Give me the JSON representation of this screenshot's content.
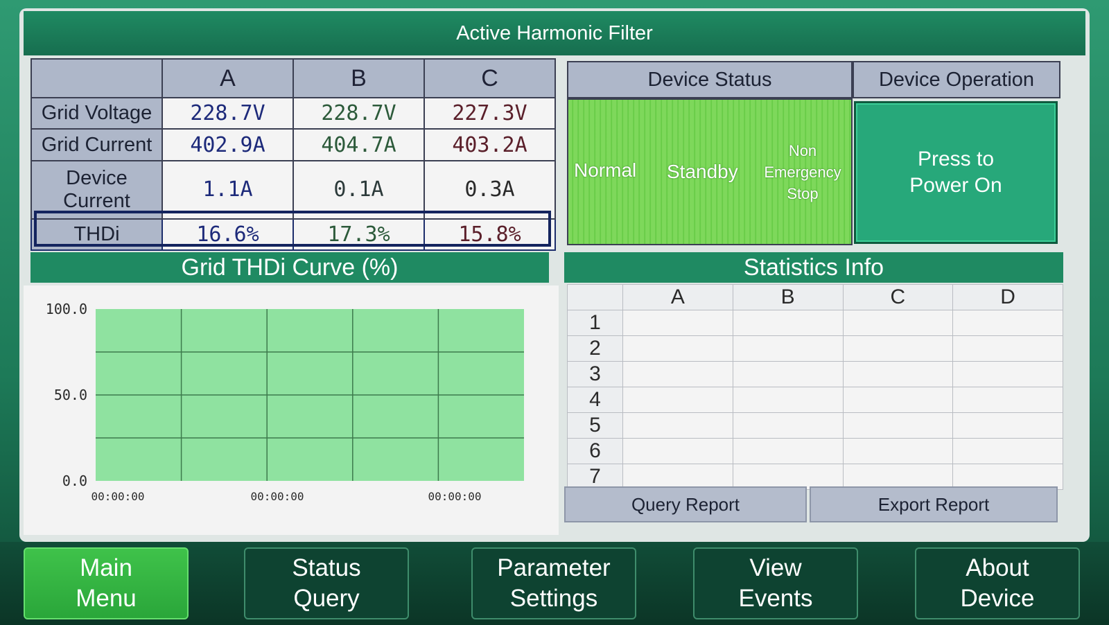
{
  "app": {
    "title": "Active Harmonic Filter"
  },
  "phase_table": {
    "columns": [
      "A",
      "B",
      "C"
    ],
    "rows": [
      {
        "label": "Grid Voltage",
        "values": [
          "228.7V",
          "228.7V",
          "227.3V"
        ]
      },
      {
        "label": "Grid Current",
        "values": [
          "402.9A",
          "404.7A",
          "403.2A"
        ]
      },
      {
        "label": "Device Current",
        "values": [
          "1.1A",
          "0.1A",
          "0.3A"
        ]
      },
      {
        "label": "THDi",
        "values": [
          "16.6%",
          "17.3%",
          "15.8%"
        ]
      }
    ]
  },
  "device_status": {
    "header": "Device Status",
    "states": [
      "Normal",
      "Standby",
      "Non Emergency Stop"
    ],
    "indicator_color": "#7ed85b"
  },
  "device_operation": {
    "header": "Device Operation",
    "button_label": "Press to Power On",
    "button_color": "#27a87a"
  },
  "thdi_curve": {
    "title": "Grid THDi Curve (%)",
    "y_ticks": [
      "100.0",
      "50.0",
      "0.0"
    ],
    "x_ticks": [
      "00:00:00",
      "00:00:00",
      "00:00:00"
    ],
    "plot_color": "#8fe2a0"
  },
  "chart_data": {
    "type": "line",
    "title": "Grid THDi Curve (%)",
    "ylim": [
      0,
      100
    ],
    "y_ticks": [
      100,
      50,
      0
    ],
    "x_tick_labels": [
      "00:00:00",
      "00:00:00",
      "00:00:00"
    ],
    "series": [],
    "grid": true
  },
  "statistics": {
    "title": "Statistics Info",
    "columns": [
      "A",
      "B",
      "C",
      "D"
    ],
    "rows": [
      "1",
      "2",
      "3",
      "4",
      "5",
      "6",
      "7"
    ],
    "query_label": "Query Report",
    "export_label": "Export Report"
  },
  "nav": [
    {
      "label": "Main Menu",
      "active": true
    },
    {
      "label": "Status Query",
      "active": false
    },
    {
      "label": "Parameter Settings",
      "active": false
    },
    {
      "label": "View Events",
      "active": false
    },
    {
      "label": "About Device",
      "active": false
    }
  ]
}
